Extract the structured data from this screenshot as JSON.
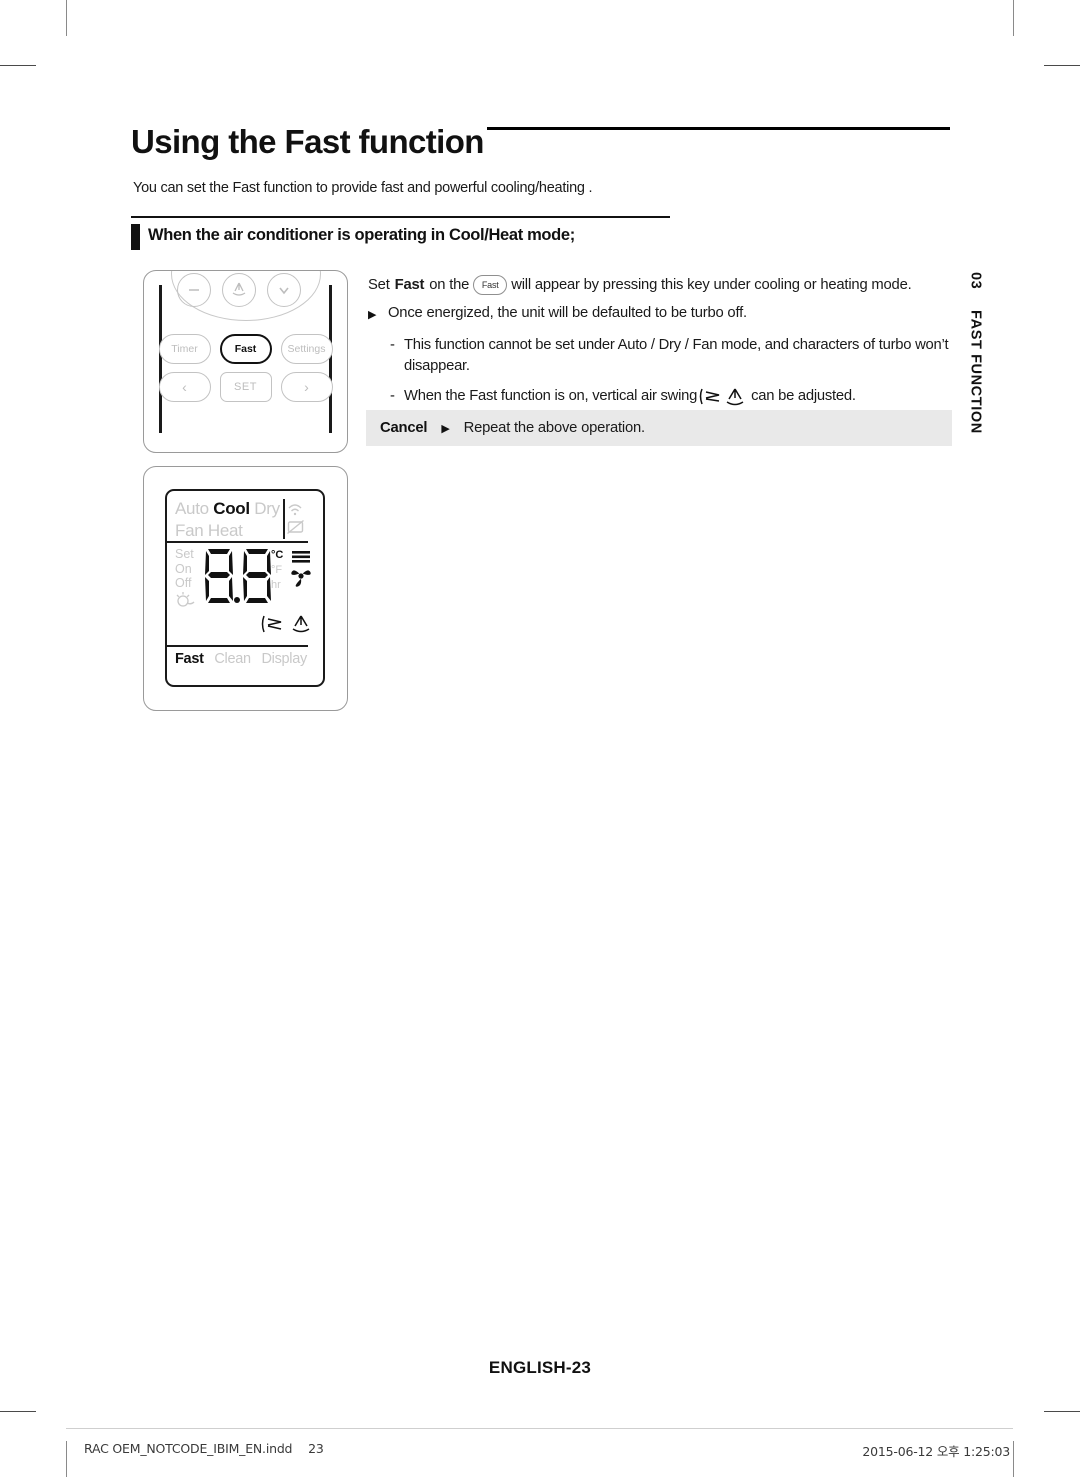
{
  "document": {
    "title": "Using the Fast function",
    "intro": "You can set the Fast function to provide fast and powerful cooling/heating .",
    "subsection_title": "When the air conditioner is operating in Cool/Heat  mode;",
    "page_number_label": "ENGLISH-23"
  },
  "side_tab": {
    "chapter_number": "03",
    "chapter_name": "FAST FUNCTION"
  },
  "remote": {
    "round_buttons": [
      {
        "name": "minus-button",
        "glyph": "—"
      },
      {
        "name": "power-swing-button",
        "glyph": ""
      },
      {
        "name": "down-button",
        "glyph": "∨"
      }
    ],
    "function_buttons": [
      {
        "label": "Timer",
        "active": false
      },
      {
        "label": "Fast",
        "active": true
      },
      {
        "label": "Settings",
        "active": false
      }
    ],
    "set_row": [
      {
        "label": "‹",
        "active": false
      },
      {
        "label": "SET",
        "active": false
      },
      {
        "label": "›",
        "active": false
      }
    ]
  },
  "lcd": {
    "modes_row1": [
      "Auto",
      "Cool",
      "Dry"
    ],
    "modes_row2": [
      "Fan",
      "Heat"
    ],
    "active_mode": "Cool",
    "timer_labels": [
      "Set",
      "On",
      "Off"
    ],
    "digits": "8.8",
    "units": [
      "°C",
      "°F",
      "hr"
    ],
    "active_unit": "°C",
    "bottom_row": [
      "Fast",
      "Clean",
      "Display"
    ],
    "active_bottom": "Fast"
  },
  "instructions": {
    "main_line_part1": "Set",
    "main_line_bold": "Fast",
    "main_line_part2": "on the",
    "inline_button_label": "Fast",
    "main_line_part3": "will appear by pressing this key under cooling or heating mode.",
    "bullet_marker": "▶",
    "bullet_text": "Once energized, the unit will be defaulted to be turbo off.",
    "dash_marker": "-",
    "dash_items": [
      {
        "text": "This function cannot be set under Auto / Dry / Fan mode, and characters of turbo won’t disappear."
      },
      {
        "text_before": "When the Fast function is on, vertical air swing",
        "text_after": "can be adjusted."
      }
    ]
  },
  "cancel": {
    "label": "Cancel",
    "marker": "▶",
    "text": "Repeat the above operation."
  },
  "footer": {
    "file_name": "RAC OEM_NOTCODE_IBIM_EN.indd",
    "page": "23",
    "timestamp": "2015-06-12   오후 1:25:03"
  },
  "colors": {
    "text": "#1a1a1a",
    "lcd_inactive": "#c9c9c9",
    "cancel_background": "#e9e9e9",
    "remote_outline": "#9a9a9a"
  }
}
